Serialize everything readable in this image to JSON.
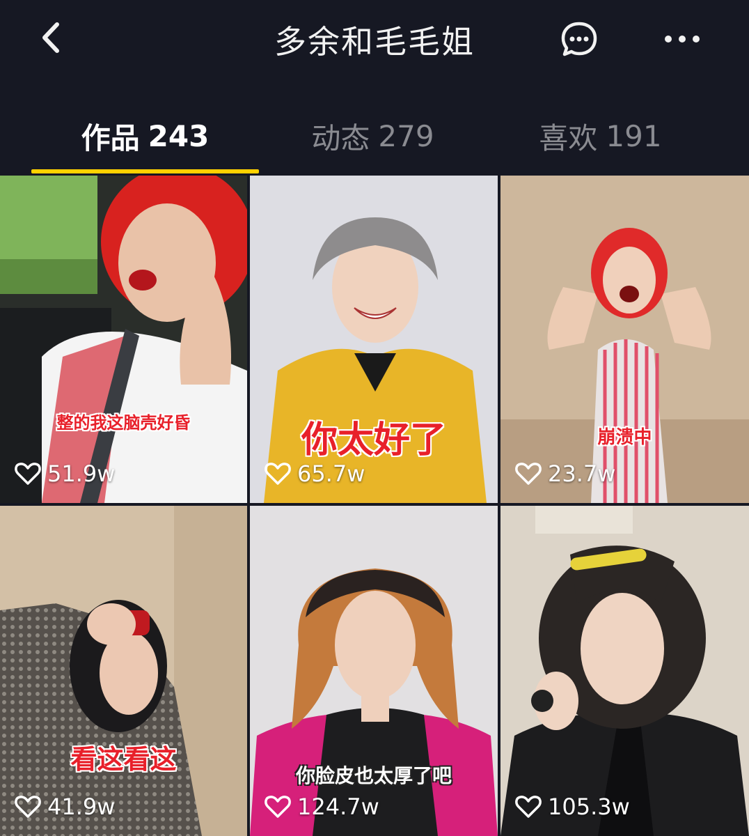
{
  "header": {
    "title": "多余和毛毛姐",
    "back_icon": "chevron-left-icon",
    "message_icon": "chat-bubble-icon",
    "more_icon": "more-dots-icon"
  },
  "tabs": [
    {
      "label": "作品",
      "count": "243",
      "active": true
    },
    {
      "label": "动态",
      "count": "279",
      "active": false
    },
    {
      "label": "喜欢",
      "count": "191",
      "active": false
    }
  ],
  "accent_color": "#ffd100",
  "videos": [
    {
      "caption": "整的我这脑壳好昏",
      "likes": "51.9w"
    },
    {
      "caption": "你太好了",
      "likes": "65.7w"
    },
    {
      "caption": "崩溃中",
      "likes": "23.7w"
    },
    {
      "caption": "看这看这",
      "likes": "41.9w"
    },
    {
      "caption": "你脸皮也太厚了吧",
      "likes": "124.7w"
    },
    {
      "caption": "",
      "likes": "105.3w"
    }
  ]
}
